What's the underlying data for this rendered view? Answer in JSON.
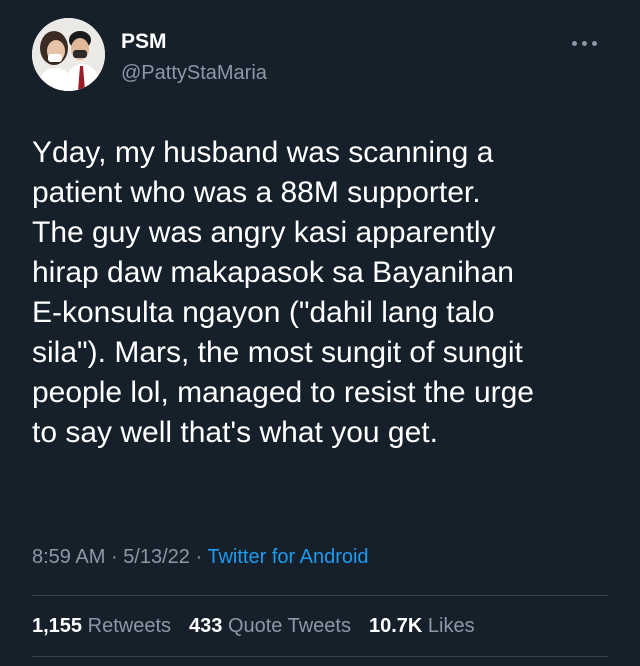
{
  "user": {
    "display_name": "PSM",
    "handle": "@PattyStaMaria"
  },
  "tweet": {
    "text": "Yday, my husband was scanning a\npatient who was a 88M supporter.\nThe guy was angry kasi apparently\nhirap daw makapasok sa Bayanihan\nE-konsulta ngayon (\"dahil lang talo\nsila\"). Mars, the most sungit of sungit\npeople lol, managed to resist the urge\nto say well that's what you get.",
    "time": "8:59 AM",
    "date": "5/13/22",
    "separator": "·",
    "source": "Twitter for Android"
  },
  "stats": {
    "retweets_count": "1,155",
    "retweets_label": "Retweets",
    "quotes_count": "433",
    "quotes_label": "Quote Tweets",
    "likes_count": "10.7K",
    "likes_label": "Likes"
  },
  "icons": {
    "more": "more-horizontal-icon",
    "avatar": "profile-photo"
  },
  "colors": {
    "background": "#15202b",
    "text": "#ffffff",
    "secondary": "#8b98a5",
    "link": "#1d9bf0",
    "divider": "#38444d"
  }
}
